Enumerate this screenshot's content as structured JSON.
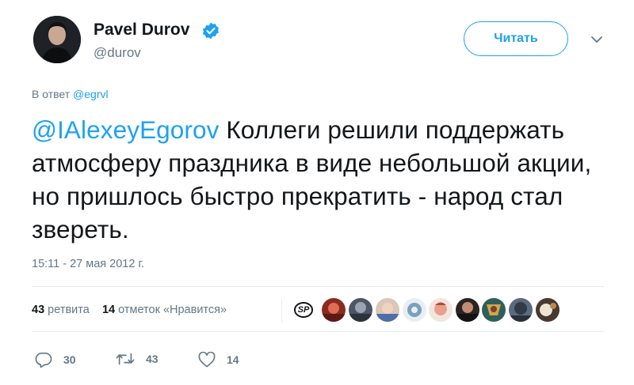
{
  "author": {
    "name": "Pavel Durov",
    "handle": "@durov",
    "verified": true
  },
  "follow_button": {
    "label": "Читать"
  },
  "reply_to": {
    "prefix": "В ответ",
    "mention": "@egrvl"
  },
  "tweet": {
    "mention": "@IAlexeyEgorov",
    "text": " Коллеги решили поддержать атмосферу праздника в виде небольшой акции, но пришлось быстро прекратить - народ стал звереть."
  },
  "timestamp": "15:11 - 27 мая 2012 г.",
  "stats": {
    "retweets_count": "43",
    "retweets_label": "ретвита",
    "likes_count": "14",
    "likes_label": "отметок «Нравится»"
  },
  "likers": {
    "first_label": "SP"
  },
  "actions": {
    "reply_count": "30",
    "retweet_count": "43",
    "like_count": "14"
  },
  "colors": {
    "accent": "#1da1f2",
    "muted": "#657786",
    "text": "#14171a",
    "divider": "#e6ecf0"
  }
}
